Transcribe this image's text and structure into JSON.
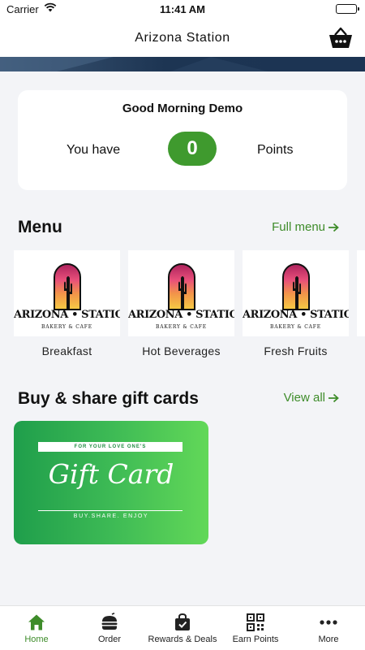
{
  "status_bar": {
    "carrier": "Carrier",
    "time": "11:41 AM"
  },
  "header": {
    "title": "Arizona Station",
    "cart_icon": "basket-icon"
  },
  "greeting": {
    "message": "Good Morning Demo",
    "prefix": "You have",
    "points": "0",
    "suffix": "Points"
  },
  "menu": {
    "title": "Menu",
    "link": "Full menu",
    "items": [
      {
        "label": "Breakfast"
      },
      {
        "label": "Hot Beverages"
      },
      {
        "label": "Fresh Fruits"
      }
    ],
    "logo": {
      "name": "ARIZONA • STATION",
      "sub": "BAKERY & CAFE"
    }
  },
  "gift_cards": {
    "title": "Buy & share gift cards",
    "link": "View all",
    "card": {
      "top_text": "FOR YOUR LOVE ONE'S",
      "title": "Gift Card",
      "tagline": "BUY.SHARE. ENJOY"
    }
  },
  "tabs": [
    {
      "label": "Home",
      "icon": "home-icon",
      "active": true
    },
    {
      "label": "Order",
      "icon": "burger-icon",
      "active": false
    },
    {
      "label": "Rewards & Deals",
      "icon": "bag-check-icon",
      "active": false
    },
    {
      "label": "Earn Points",
      "icon": "qr-code-icon",
      "active": false
    },
    {
      "label": "More",
      "icon": "more-dots-icon",
      "active": false
    }
  ],
  "colors": {
    "accent": "#3e8c2a",
    "points_pill": "#3f9a2e",
    "banner": "#1d3553",
    "gift_start": "#1f9e4b",
    "gift_end": "#62d858"
  }
}
